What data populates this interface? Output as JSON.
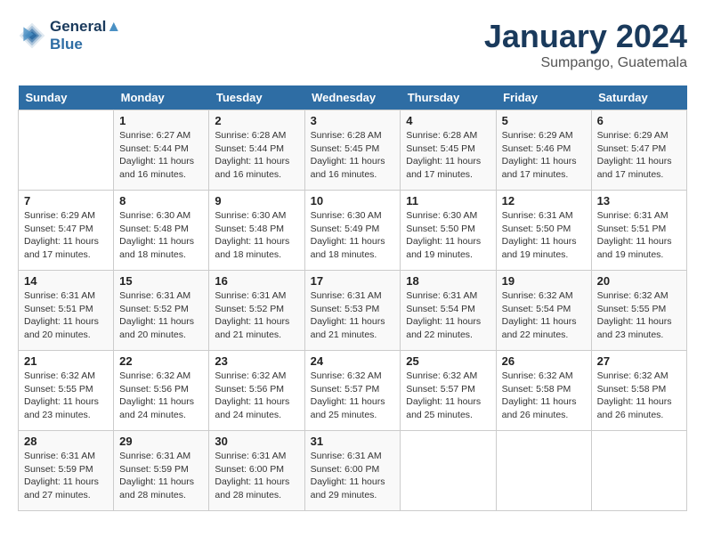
{
  "header": {
    "logo_line1": "General",
    "logo_line2": "Blue",
    "month_title": "January 2024",
    "location": "Sumpango, Guatemala"
  },
  "days_of_week": [
    "Sunday",
    "Monday",
    "Tuesday",
    "Wednesday",
    "Thursday",
    "Friday",
    "Saturday"
  ],
  "weeks": [
    [
      {
        "num": "",
        "info": ""
      },
      {
        "num": "1",
        "info": "Sunrise: 6:27 AM\nSunset: 5:44 PM\nDaylight: 11 hours and 16 minutes."
      },
      {
        "num": "2",
        "info": "Sunrise: 6:28 AM\nSunset: 5:44 PM\nDaylight: 11 hours and 16 minutes."
      },
      {
        "num": "3",
        "info": "Sunrise: 6:28 AM\nSunset: 5:45 PM\nDaylight: 11 hours and 16 minutes."
      },
      {
        "num": "4",
        "info": "Sunrise: 6:28 AM\nSunset: 5:45 PM\nDaylight: 11 hours and 17 minutes."
      },
      {
        "num": "5",
        "info": "Sunrise: 6:29 AM\nSunset: 5:46 PM\nDaylight: 11 hours and 17 minutes."
      },
      {
        "num": "6",
        "info": "Sunrise: 6:29 AM\nSunset: 5:47 PM\nDaylight: 11 hours and 17 minutes."
      }
    ],
    [
      {
        "num": "7",
        "info": "Sunrise: 6:29 AM\nSunset: 5:47 PM\nDaylight: 11 hours and 17 minutes."
      },
      {
        "num": "8",
        "info": "Sunrise: 6:30 AM\nSunset: 5:48 PM\nDaylight: 11 hours and 18 minutes."
      },
      {
        "num": "9",
        "info": "Sunrise: 6:30 AM\nSunset: 5:48 PM\nDaylight: 11 hours and 18 minutes."
      },
      {
        "num": "10",
        "info": "Sunrise: 6:30 AM\nSunset: 5:49 PM\nDaylight: 11 hours and 18 minutes."
      },
      {
        "num": "11",
        "info": "Sunrise: 6:30 AM\nSunset: 5:50 PM\nDaylight: 11 hours and 19 minutes."
      },
      {
        "num": "12",
        "info": "Sunrise: 6:31 AM\nSunset: 5:50 PM\nDaylight: 11 hours and 19 minutes."
      },
      {
        "num": "13",
        "info": "Sunrise: 6:31 AM\nSunset: 5:51 PM\nDaylight: 11 hours and 19 minutes."
      }
    ],
    [
      {
        "num": "14",
        "info": "Sunrise: 6:31 AM\nSunset: 5:51 PM\nDaylight: 11 hours and 20 minutes."
      },
      {
        "num": "15",
        "info": "Sunrise: 6:31 AM\nSunset: 5:52 PM\nDaylight: 11 hours and 20 minutes."
      },
      {
        "num": "16",
        "info": "Sunrise: 6:31 AM\nSunset: 5:52 PM\nDaylight: 11 hours and 21 minutes."
      },
      {
        "num": "17",
        "info": "Sunrise: 6:31 AM\nSunset: 5:53 PM\nDaylight: 11 hours and 21 minutes."
      },
      {
        "num": "18",
        "info": "Sunrise: 6:31 AM\nSunset: 5:54 PM\nDaylight: 11 hours and 22 minutes."
      },
      {
        "num": "19",
        "info": "Sunrise: 6:32 AM\nSunset: 5:54 PM\nDaylight: 11 hours and 22 minutes."
      },
      {
        "num": "20",
        "info": "Sunrise: 6:32 AM\nSunset: 5:55 PM\nDaylight: 11 hours and 23 minutes."
      }
    ],
    [
      {
        "num": "21",
        "info": "Sunrise: 6:32 AM\nSunset: 5:55 PM\nDaylight: 11 hours and 23 minutes."
      },
      {
        "num": "22",
        "info": "Sunrise: 6:32 AM\nSunset: 5:56 PM\nDaylight: 11 hours and 24 minutes."
      },
      {
        "num": "23",
        "info": "Sunrise: 6:32 AM\nSunset: 5:56 PM\nDaylight: 11 hours and 24 minutes."
      },
      {
        "num": "24",
        "info": "Sunrise: 6:32 AM\nSunset: 5:57 PM\nDaylight: 11 hours and 25 minutes."
      },
      {
        "num": "25",
        "info": "Sunrise: 6:32 AM\nSunset: 5:57 PM\nDaylight: 11 hours and 25 minutes."
      },
      {
        "num": "26",
        "info": "Sunrise: 6:32 AM\nSunset: 5:58 PM\nDaylight: 11 hours and 26 minutes."
      },
      {
        "num": "27",
        "info": "Sunrise: 6:32 AM\nSunset: 5:58 PM\nDaylight: 11 hours and 26 minutes."
      }
    ],
    [
      {
        "num": "28",
        "info": "Sunrise: 6:31 AM\nSunset: 5:59 PM\nDaylight: 11 hours and 27 minutes."
      },
      {
        "num": "29",
        "info": "Sunrise: 6:31 AM\nSunset: 5:59 PM\nDaylight: 11 hours and 28 minutes."
      },
      {
        "num": "30",
        "info": "Sunrise: 6:31 AM\nSunset: 6:00 PM\nDaylight: 11 hours and 28 minutes."
      },
      {
        "num": "31",
        "info": "Sunrise: 6:31 AM\nSunset: 6:00 PM\nDaylight: 11 hours and 29 minutes."
      },
      {
        "num": "",
        "info": ""
      },
      {
        "num": "",
        "info": ""
      },
      {
        "num": "",
        "info": ""
      }
    ]
  ]
}
